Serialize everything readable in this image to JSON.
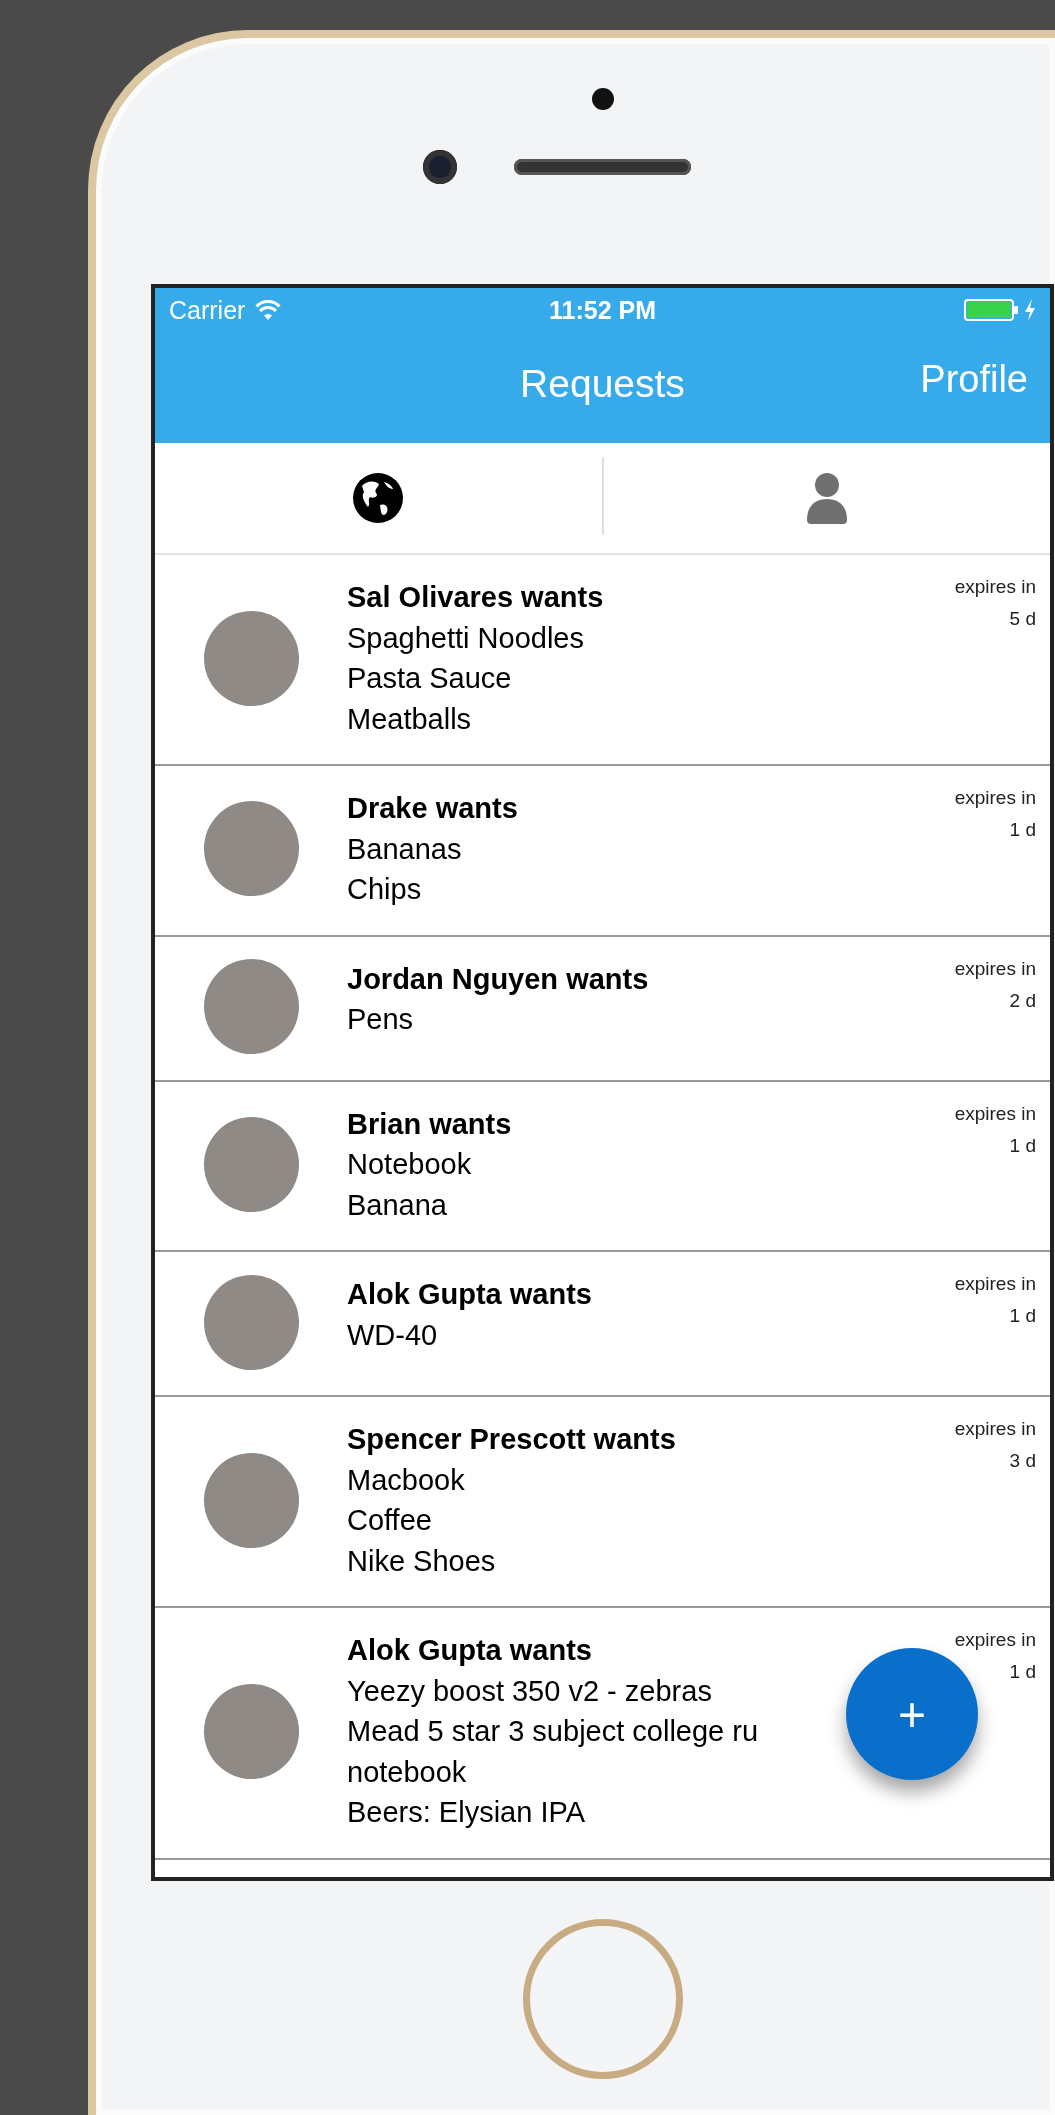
{
  "status_bar": {
    "carrier": "Carrier",
    "time": "11:52 PM"
  },
  "nav": {
    "title": "Requests",
    "right_button": "Profile"
  },
  "filters": [
    {
      "kind": "globe",
      "selected": true
    },
    {
      "kind": "person",
      "selected": false
    }
  ],
  "requests": [
    {
      "title": "Sal Olivares wants",
      "items": [
        "Spaghetti Noodles",
        "Pasta Sauce",
        "Meatballs"
      ],
      "expires_label": "expires in",
      "expires_value": "5 d"
    },
    {
      "title": "Drake wants",
      "items": [
        "Bananas",
        "Chips"
      ],
      "expires_label": "expires in",
      "expires_value": "1 d"
    },
    {
      "title": "Jordan Nguyen wants",
      "items": [
        "Pens"
      ],
      "expires_label": "expires in",
      "expires_value": "2 d"
    },
    {
      "title": "Brian wants",
      "items": [
        "Notebook",
        "Banana"
      ],
      "expires_label": "expires in",
      "expires_value": "1 d"
    },
    {
      "title": "Alok Gupta wants",
      "items": [
        "WD-40"
      ],
      "expires_label": "expires in",
      "expires_value": "1 d"
    },
    {
      "title": "Spencer Prescott wants",
      "items": [
        "Macbook",
        "Coffee",
        "Nike Shoes"
      ],
      "expires_label": "expires in",
      "expires_value": "3 d"
    },
    {
      "title": "Alok Gupta wants",
      "items": [
        "Yeezy boost 350 v2 - zebras",
        "Mead 5 star 3 subject college ru",
        "notebook",
        "Beers: Elysian IPA"
      ],
      "expires_label": "expires in",
      "expires_value": "1 d"
    }
  ],
  "fab": {
    "label": "+"
  }
}
